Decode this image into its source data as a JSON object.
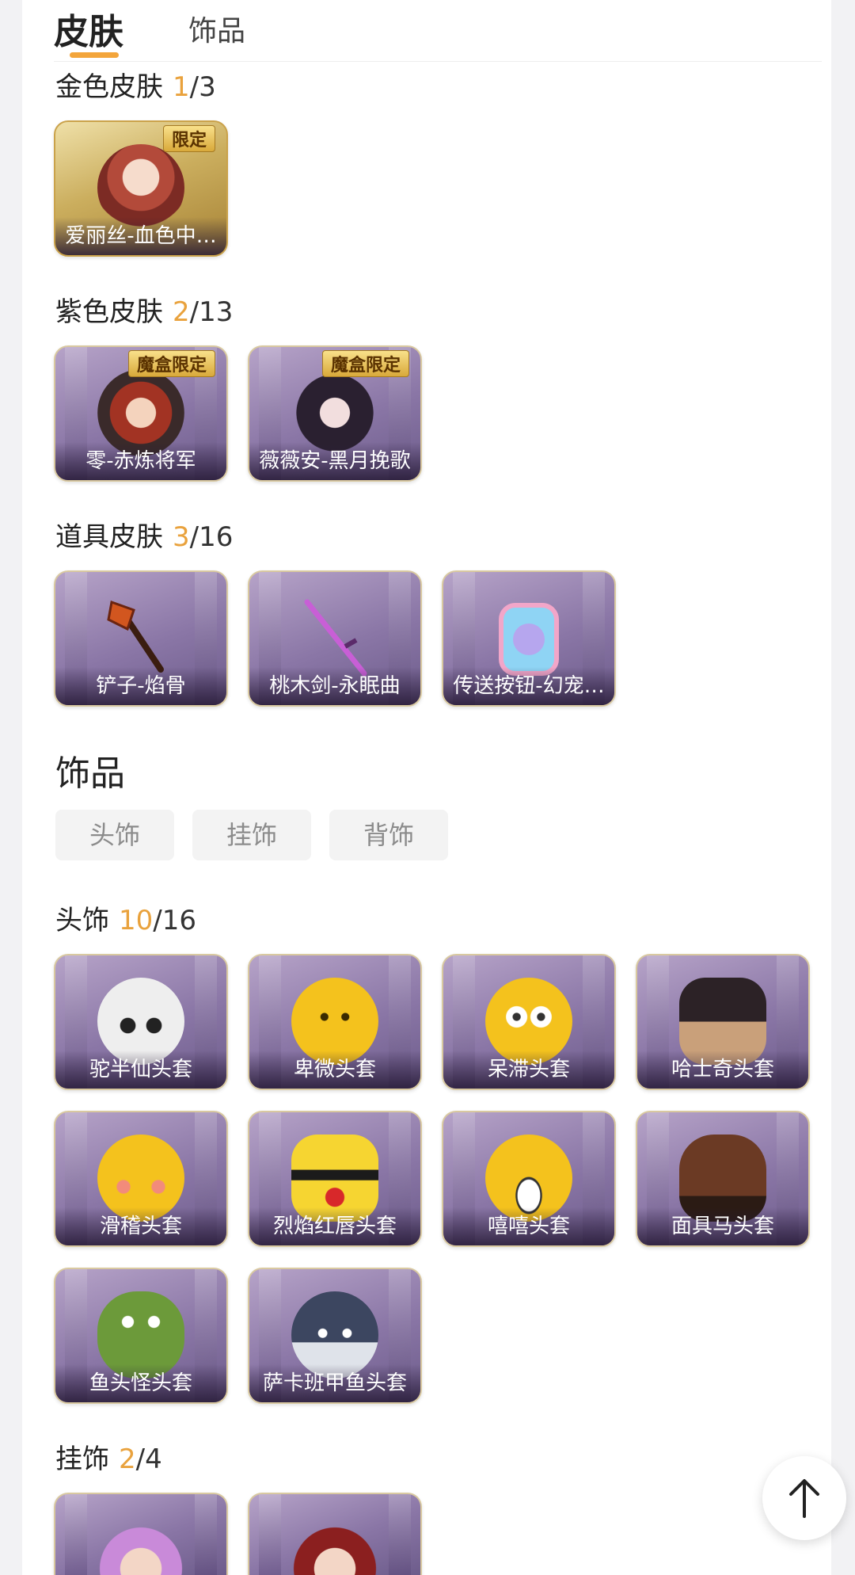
{
  "tabs": {
    "active": "皮肤",
    "inactive": "饰品"
  },
  "sections": {
    "gold": {
      "title": "金色皮肤",
      "owned": "1",
      "total": "/3",
      "items": [
        {
          "label": "爱丽丝-血色中…",
          "badge": "限定"
        }
      ]
    },
    "purple": {
      "title": "紫色皮肤",
      "owned": "2",
      "total": "/13",
      "items": [
        {
          "label": "零-赤炼将军",
          "badge": "魔盒限定"
        },
        {
          "label": "薇薇安-黑月挽歌",
          "badge": "魔盒限定"
        }
      ]
    },
    "tool": {
      "title": "道具皮肤",
      "owned": "3",
      "total": "/16",
      "items": [
        {
          "label": "铲子-焰骨"
        },
        {
          "label": "桃木剑-永眠曲"
        },
        {
          "label": "传送按钮-幻宠…"
        }
      ]
    },
    "accessories_title": "饰品",
    "filters": [
      "头饰",
      "挂饰",
      "背饰"
    ],
    "head": {
      "title": "头饰",
      "owned": "10",
      "total": "/16",
      "items": [
        {
          "label": "驼半仙头套"
        },
        {
          "label": "卑微头套"
        },
        {
          "label": "呆滞头套"
        },
        {
          "label": "哈士奇头套"
        },
        {
          "label": "滑稽头套"
        },
        {
          "label": "烈焰红唇头套"
        },
        {
          "label": "嘻嘻头套"
        },
        {
          "label": "面具马头套"
        },
        {
          "label": "鱼头怪头套"
        },
        {
          "label": "萨卡班甲鱼头套"
        }
      ]
    },
    "pendant": {
      "title": "挂饰",
      "owned": "2",
      "total": "/4",
      "items": [
        {
          "label": ""
        },
        {
          "label": ""
        }
      ]
    }
  }
}
